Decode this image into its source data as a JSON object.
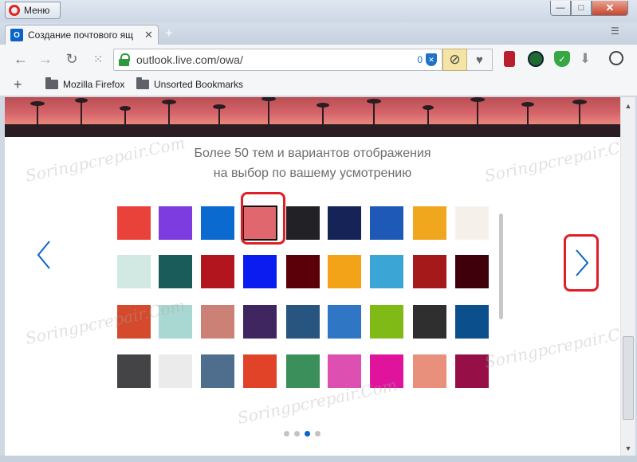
{
  "window": {
    "menu_label": "Меню",
    "minimize": "—",
    "maximize": "□",
    "close": "✕"
  },
  "tab": {
    "title": "Создание почтового ящ",
    "favicon": "O",
    "close": "✕",
    "new_tab": "+"
  },
  "toolbar": {
    "back": "←",
    "forward": "→",
    "reload": "↻",
    "speed_dial": "⁙",
    "url": "outlook.live.com/owa/",
    "blocked_count": "0",
    "adblock": "⊘",
    "heart": "♥",
    "download": "⬇",
    "power": "⏻"
  },
  "bookmarks": {
    "add": "+",
    "items": [
      "Mozilla Firefox",
      "Unsorted Bookmarks"
    ]
  },
  "page": {
    "heading_line1": "Более 50 тем и вариантов отображения",
    "heading_line2": "на выбор по вашему усмотрению",
    "prev": "‹",
    "next": "›",
    "active_dot": 3,
    "dot_count": 4,
    "selected_theme": 3
  },
  "themes": [
    [
      "#e8423a",
      "#7c3ce0",
      "#0b6ad0",
      "#e0676e",
      "#222226",
      "#162357",
      "#1f59b8",
      "#f1a71d",
      "#f5f1ea"
    ],
    [
      "#d2e9e3",
      "#1a5c59",
      "#b3151f",
      "#0a1cf0",
      "#5b0009",
      "#f2a318",
      "#3ba6d6",
      "#a6191b",
      "#3f000b"
    ],
    [
      "#d54a2d",
      "#a9d7d1",
      "#cc8176",
      "#402660",
      "#28557f",
      "#2f77c4",
      "#80ba17",
      "#2f2f2f",
      "#0c4f8d"
    ],
    [
      "#444446",
      "#ebebeb",
      "#4f6e8d",
      "#e04328",
      "#3a8f5b",
      "#dd4fb1",
      "#e0149c",
      "#e8907c",
      "#960f46"
    ]
  ],
  "watermark": "Soringpcrepair.Com",
  "scroll": {
    "up": "▲",
    "down": "▼"
  }
}
